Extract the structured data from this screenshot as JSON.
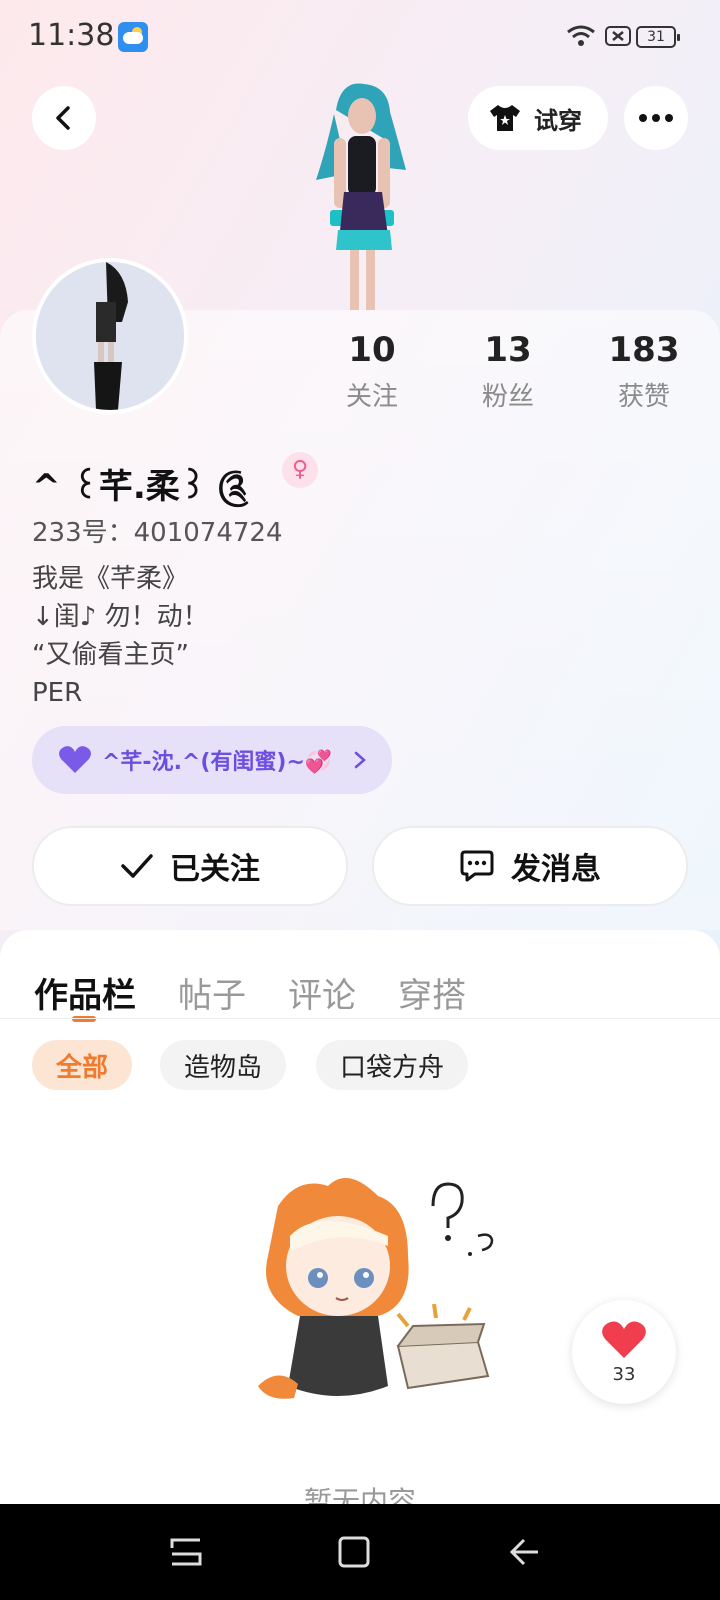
{
  "status_bar": {
    "time": "11:38",
    "battery": "31",
    "icons": [
      "weather-icon",
      "wifi-icon",
      "sim-x-icon",
      "battery-icon"
    ]
  },
  "top_nav": {
    "try_on_label": "试穿",
    "icons": [
      "back-arrow-icon",
      "shirt-icon",
      "more-dots-icon"
    ]
  },
  "profile": {
    "stats": [
      {
        "value": "10",
        "label": "关注"
      },
      {
        "value": "13",
        "label": "粉丝"
      },
      {
        "value": "183",
        "label": "获赞"
      }
    ],
    "username": "^ ꒰芊.柔꒱ ༊",
    "gender_icon": "♀",
    "user_id": "233号：401074724",
    "bio_lines": [
      "我是《芊柔》",
      "↓闺♪ 勿！动！",
      "“又偷看主页”",
      "PER"
    ],
    "relation_label": "^芊-沈.^(有闺蜜)~💞",
    "follow_label": "已关注",
    "message_label": "发消息"
  },
  "tabs": [
    {
      "label": "作品栏",
      "active": true
    },
    {
      "label": "帖子",
      "active": false
    },
    {
      "label": "评论",
      "active": false
    },
    {
      "label": "穿搭",
      "active": false
    }
  ],
  "filters": [
    {
      "label": "全部",
      "active": true
    },
    {
      "label": "造物岛",
      "active": false
    },
    {
      "label": "口袋方舟",
      "active": false
    }
  ],
  "empty_state": {
    "text": "暂无内容"
  },
  "like_widget": {
    "count": "33"
  },
  "colors": {
    "accent": "#f07a2e",
    "relation": "#6d4fe0",
    "gender": "#f25a8a"
  }
}
